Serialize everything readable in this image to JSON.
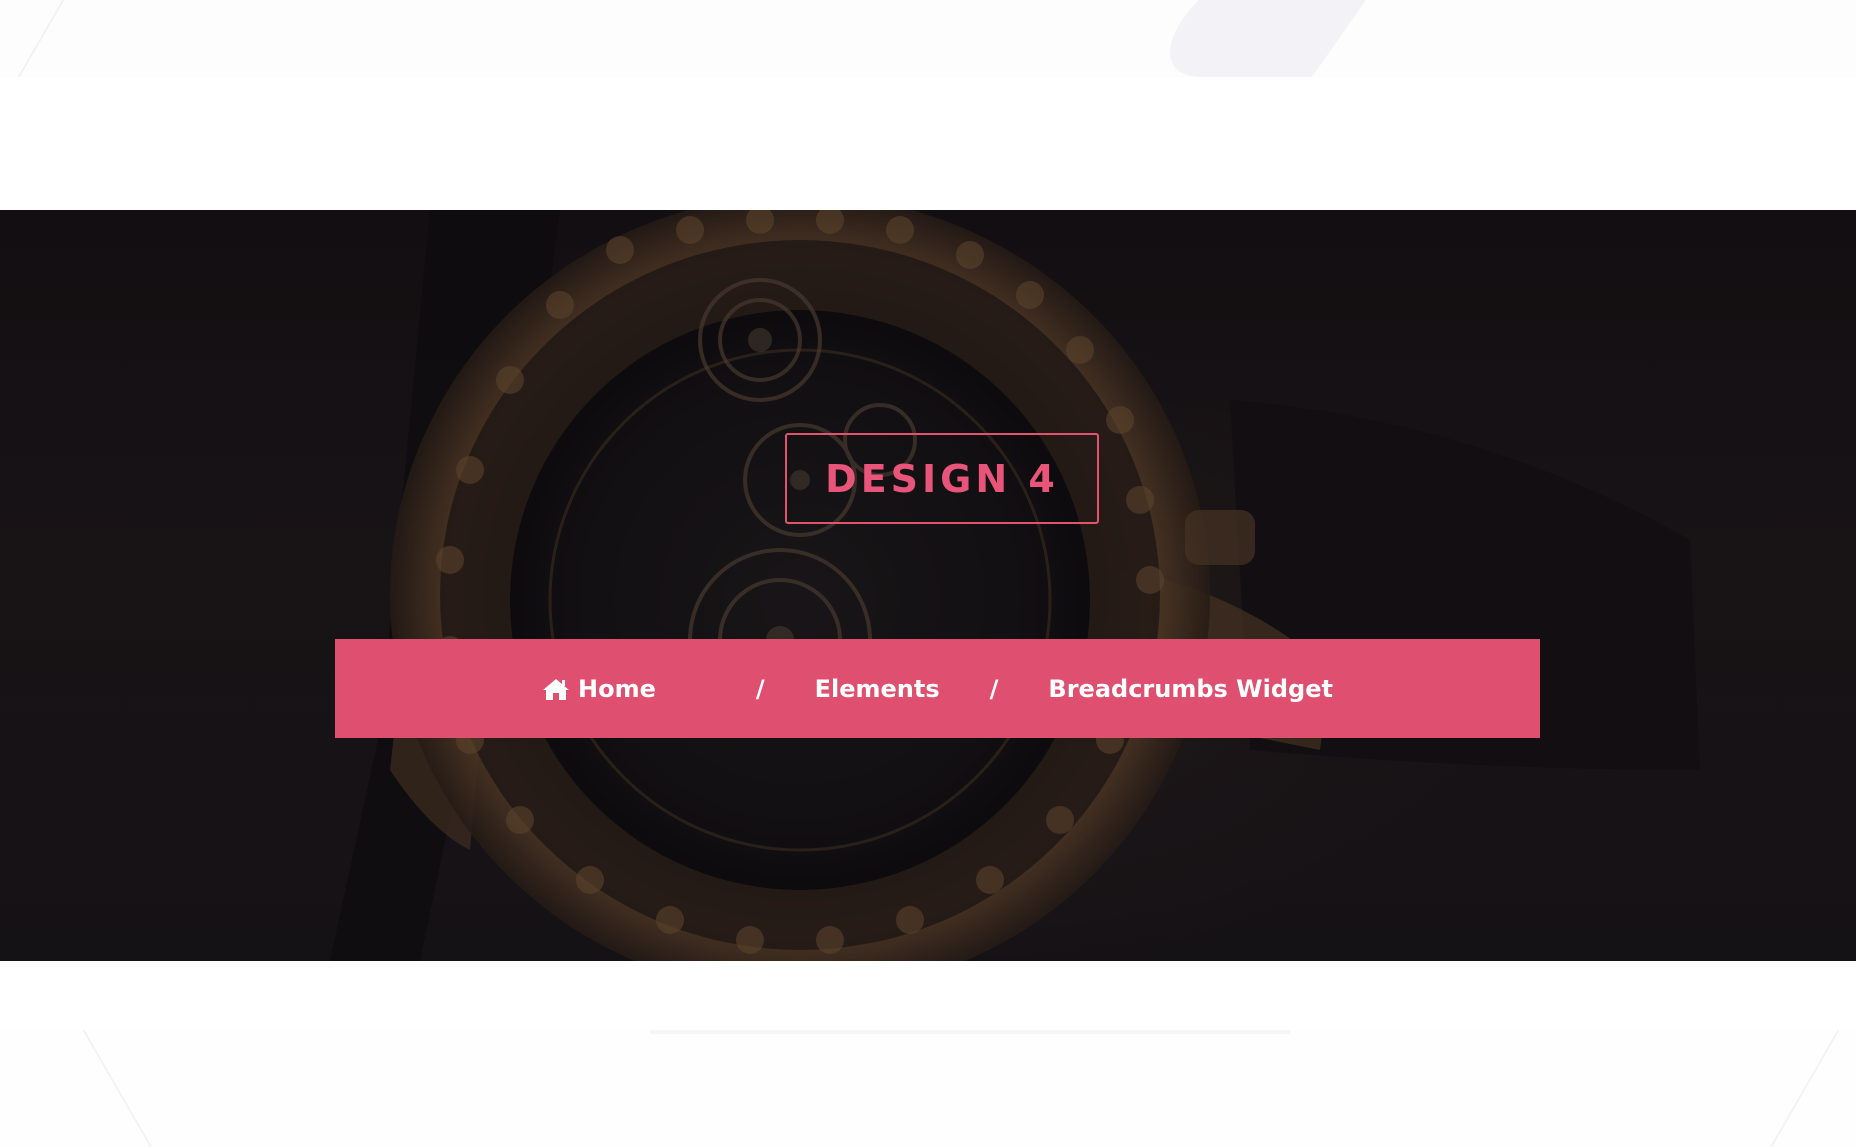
{
  "banner": {
    "title": "DESIGN 4"
  },
  "breadcrumb": {
    "items": [
      {
        "label": "Home",
        "icon": "home-icon"
      },
      {
        "label": "Elements"
      },
      {
        "label": "Breadcrumbs Widget"
      }
    ],
    "separator": "/"
  },
  "colors": {
    "accent": "#df4f70",
    "title_color": "#e9557a",
    "title_border": "#e2536f",
    "hero_background": "#1a1618",
    "page_background": "#ffffff"
  }
}
